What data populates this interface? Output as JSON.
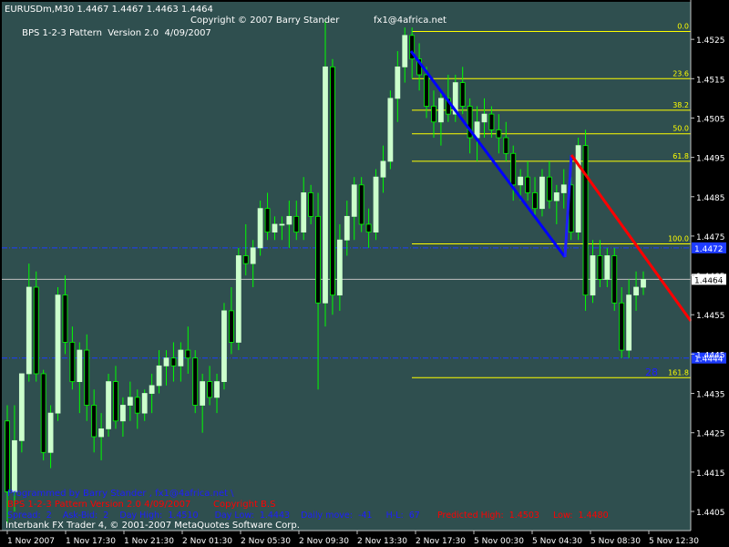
{
  "header": {
    "symbol_line": "EURUSDm,M30  1.4467 1.4467 1.4463 1.4464",
    "indicator_line": "BPS 1-2-3 Pattern  Version 2.0  4/09/2007",
    "copyright": "Copyright © 2007 Barry Stander",
    "email": "fx1@4africa.net"
  },
  "footer": {
    "programmed_by": "Programmed by Barry Stander ,  fx1@4africa.net  \\",
    "version_red": "BPS 1-2-3 Pattern  Version 2.0  4/09/2007",
    "copyright_red": "Copyright B.S",
    "stats": "Spread:  2    Ask-Bid:  2    Day High:  1.4510      Day Low:  1.4443    Daily move:  -41     H-L:  67",
    "predicted": "Predicted High:  1.4503     Low:  1.4480",
    "platform": "Interbank FX Trader 4, © 2001-2007 MetaQuotes Software Corp."
  },
  "colors": {
    "plot_bg": "#2F4F4F",
    "up_candle": "#CCFFCC",
    "down_candle": "#000000",
    "wick": "#00FF00",
    "fib": "#FFFF00",
    "leg_down": "#0000FF",
    "leg_up": "#1E1EFF",
    "projection": "#FF0000",
    "level_line": "#1E3CFF",
    "bid_line": "#C0C0C0",
    "text": "#FFFFFF",
    "programmed_text": "#1E1EFF",
    "red_text": "#FF0000"
  },
  "chart_data": {
    "type": "candlestick",
    "symbol": "EURUSDm",
    "timeframe": "M30",
    "ylim": [
      1.4405,
      1.4535
    ],
    "y_ticks": [
      "1.4525",
      "1.4515",
      "1.4505",
      "1.4495",
      "1.4485",
      "1.4475",
      "1.4465",
      "1.4455",
      "1.4445",
      "1.4435",
      "1.4425",
      "1.4415",
      "1.4405"
    ],
    "x_ticks": [
      "1 Nov 2007",
      "1 Nov 17:30",
      "1 Nov 21:30",
      "2 Nov 01:30",
      "2 Nov 05:30",
      "2 Nov 09:30",
      "2 Nov 13:30",
      "2 Nov 17:30",
      "5 Nov 00:30",
      "5 Nov 04:30",
      "5 Nov 08:30",
      "5 Nov 12:30"
    ],
    "fib_levels": [
      {
        "label": "0.0",
        "price": 1.4527
      },
      {
        "label": "23.6",
        "price": 1.4515
      },
      {
        "label": "38.2",
        "price": 1.4507
      },
      {
        "label": "50.0",
        "price": 1.4501
      },
      {
        "label": "61.8",
        "price": 1.4494
      },
      {
        "label": "100.0",
        "price": 1.4473
      },
      {
        "label": "161.8",
        "price": 1.4439
      }
    ],
    "level_lines": [
      {
        "label": "1.4472",
        "price": 1.4472
      },
      {
        "label": "1.4444",
        "price": 1.4444
      }
    ],
    "bid_price": "1.4464",
    "counter_label": "28",
    "candles": [
      [
        1.4428,
        1.4432,
        1.4402,
        1.441
      ],
      [
        1.441,
        1.4432,
        1.4405,
        1.4423
      ],
      [
        1.4423,
        1.444,
        1.442,
        1.444
      ],
      [
        1.444,
        1.4468,
        1.4438,
        1.4462
      ],
      [
        1.4462,
        1.4466,
        1.4438,
        1.444
      ],
      [
        1.444,
        1.4441,
        1.4418,
        1.442
      ],
      [
        1.442,
        1.4432,
        1.4416,
        1.443
      ],
      [
        1.443,
        1.4462,
        1.4428,
        1.446
      ],
      [
        1.446,
        1.4465,
        1.4445,
        1.4448
      ],
      [
        1.4448,
        1.4452,
        1.4436,
        1.4438
      ],
      [
        1.4438,
        1.4448,
        1.443,
        1.4446
      ],
      [
        1.4446,
        1.445,
        1.4428,
        1.4432
      ],
      [
        1.4432,
        1.4436,
        1.442,
        1.4424
      ],
      [
        1.4424,
        1.443,
        1.4418,
        1.4426
      ],
      [
        1.4426,
        1.444,
        1.4424,
        1.4438
      ],
      [
        1.4438,
        1.4442,
        1.4426,
        1.4428
      ],
      [
        1.4428,
        1.4434,
        1.4424,
        1.4432
      ],
      [
        1.4432,
        1.4438,
        1.4428,
        1.4434
      ],
      [
        1.4434,
        1.4436,
        1.4426,
        1.443
      ],
      [
        1.443,
        1.4436,
        1.4428,
        1.4435
      ],
      [
        1.4435,
        1.444,
        1.443,
        1.4437
      ],
      [
        1.4437,
        1.4446,
        1.4435,
        1.4442
      ],
      [
        1.4442,
        1.4446,
        1.4437,
        1.4444
      ],
      [
        1.4444,
        1.4448,
        1.4438,
        1.4442
      ],
      [
        1.4442,
        1.4448,
        1.4438,
        1.4446
      ],
      [
        1.4446,
        1.4452,
        1.444,
        1.4444
      ],
      [
        1.4444,
        1.4446,
        1.443,
        1.4432
      ],
      [
        1.4432,
        1.444,
        1.4425,
        1.4438
      ],
      [
        1.4438,
        1.4442,
        1.4432,
        1.4434
      ],
      [
        1.4434,
        1.444,
        1.443,
        1.4438
      ],
      [
        1.4438,
        1.4458,
        1.4436,
        1.4456
      ],
      [
        1.4456,
        1.4462,
        1.4445,
        1.4448
      ],
      [
        1.4448,
        1.4472,
        1.4446,
        1.447
      ],
      [
        1.447,
        1.4478,
        1.4465,
        1.4468
      ],
      [
        1.4468,
        1.4474,
        1.4462,
        1.4472
      ],
      [
        1.4472,
        1.4484,
        1.447,
        1.4482
      ],
      [
        1.4482,
        1.4486,
        1.4474,
        1.4476
      ],
      [
        1.4476,
        1.448,
        1.4474,
        1.4478
      ],
      [
        1.4478,
        1.448,
        1.4474,
        1.4478
      ],
      [
        1.4478,
        1.4484,
        1.4472,
        1.448
      ],
      [
        1.448,
        1.4484,
        1.4474,
        1.4476
      ],
      [
        1.4476,
        1.449,
        1.4474,
        1.4486
      ],
      [
        1.4486,
        1.4488,
        1.4478,
        1.448
      ],
      [
        1.448,
        1.4486,
        1.4436,
        1.4458
      ],
      [
        1.4458,
        1.453,
        1.4452,
        1.4518
      ],
      [
        1.4518,
        1.452,
        1.4455,
        1.446
      ],
      [
        1.446,
        1.4478,
        1.4456,
        1.4474
      ],
      [
        1.4474,
        1.4484,
        1.447,
        1.448
      ],
      [
        1.448,
        1.449,
        1.4474,
        1.4488
      ],
      [
        1.4488,
        1.449,
        1.4476,
        1.4478
      ],
      [
        1.4478,
        1.4482,
        1.4472,
        1.4476
      ],
      [
        1.4476,
        1.4492,
        1.4474,
        1.449
      ],
      [
        1.449,
        1.4498,
        1.4486,
        1.4494
      ],
      [
        1.4494,
        1.4512,
        1.4492,
        1.451
      ],
      [
        1.451,
        1.4522,
        1.4504,
        1.4518
      ],
      [
        1.4518,
        1.4528,
        1.4514,
        1.4526
      ],
      [
        1.4526,
        1.4528,
        1.4515,
        1.452
      ],
      [
        1.452,
        1.4524,
        1.4512,
        1.4516
      ],
      [
        1.4516,
        1.4518,
        1.4505,
        1.4508
      ],
      [
        1.4508,
        1.4512,
        1.45,
        1.4504
      ],
      [
        1.4504,
        1.4512,
        1.4498,
        1.451
      ],
      [
        1.451,
        1.4516,
        1.4504,
        1.4506
      ],
      [
        1.4506,
        1.4516,
        1.4504,
        1.4514
      ],
      [
        1.4514,
        1.4518,
        1.4506,
        1.4508
      ],
      [
        1.4508,
        1.451,
        1.4496,
        1.45
      ],
      [
        1.45,
        1.4508,
        1.4494,
        1.4504
      ],
      [
        1.4504,
        1.451,
        1.45,
        1.4506
      ],
      [
        1.4506,
        1.4508,
        1.45,
        1.4502
      ],
      [
        1.4502,
        1.4506,
        1.4496,
        1.45
      ],
      [
        1.45,
        1.4504,
        1.4494,
        1.4496
      ],
      [
        1.4496,
        1.4498,
        1.4484,
        1.4488
      ],
      [
        1.4488,
        1.4492,
        1.4484,
        1.449
      ],
      [
        1.449,
        1.4494,
        1.4484,
        1.4486
      ],
      [
        1.4486,
        1.449,
        1.448,
        1.4482
      ],
      [
        1.4482,
        1.4492,
        1.448,
        1.449
      ],
      [
        1.449,
        1.4494,
        1.4482,
        1.4484
      ],
      [
        1.4484,
        1.4488,
        1.4478,
        1.4486
      ],
      [
        1.4486,
        1.4492,
        1.4482,
        1.4488
      ],
      [
        1.4488,
        1.449,
        1.4474,
        1.4476
      ],
      [
        1.4476,
        1.45,
        1.4474,
        1.4498
      ],
      [
        1.4498,
        1.4502,
        1.4456,
        1.446
      ],
      [
        1.446,
        1.4474,
        1.4458,
        1.447
      ],
      [
        1.447,
        1.4474,
        1.4462,
        1.4464
      ],
      [
        1.4464,
        1.4472,
        1.4462,
        1.447
      ],
      [
        1.447,
        1.4472,
        1.4456,
        1.4458
      ],
      [
        1.4458,
        1.4462,
        1.4444,
        1.4446
      ],
      [
        1.4446,
        1.4464,
        1.4444,
        1.446
      ],
      [
        1.446,
        1.4466,
        1.4456,
        1.4462
      ],
      [
        1.4462,
        1.4466,
        1.446,
        1.4464
      ]
    ],
    "lines": {
      "leg_down": [
        [
          451,
          56
        ],
        [
          620,
          282
        ]
      ],
      "leg_up": [
        [
          620,
          282
        ],
        [
          627,
          170
        ]
      ],
      "projection": [
        [
          627,
          170
        ],
        [
          758,
          352
        ]
      ]
    }
  }
}
